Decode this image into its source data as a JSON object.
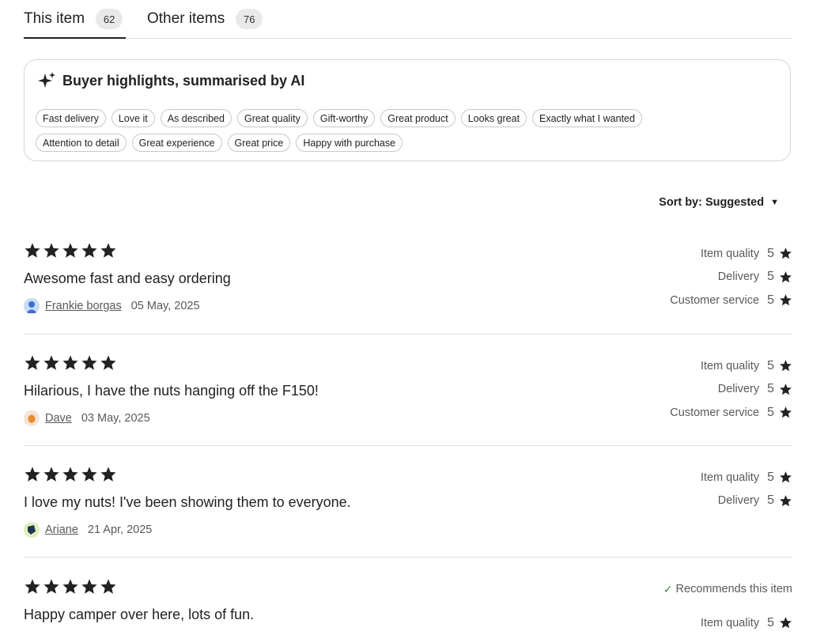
{
  "tabs": [
    {
      "label": "This item",
      "count": "62"
    },
    {
      "label": "Other items",
      "count": "76"
    }
  ],
  "highlights": {
    "title": "Buyer highlights, summarised by AI",
    "chips_row1": [
      "Fast delivery",
      "Love it",
      "As described",
      "Great quality",
      "Gift-worthy",
      "Great product",
      "Looks great",
      "Exactly what I wanted"
    ],
    "chips_row2": [
      "Attention to detail",
      "Great experience",
      "Great price",
      "Happy with purchase"
    ]
  },
  "sort": {
    "label": "Sort by: Suggested"
  },
  "reviews": [
    {
      "rating": 5,
      "text": "Awesome fast and easy ordering",
      "reviewer": "Frankie borgas",
      "date": "05 May, 2025",
      "ratings": [
        {
          "label": "Item quality",
          "value": "5"
        },
        {
          "label": "Delivery",
          "value": "5"
        },
        {
          "label": "Customer service",
          "value": "5"
        }
      ]
    },
    {
      "rating": 5,
      "text": "Hilarious, I have the nuts hanging off the F150!",
      "reviewer": "Dave",
      "date": "03 May, 2025",
      "ratings": [
        {
          "label": "Item quality",
          "value": "5"
        },
        {
          "label": "Delivery",
          "value": "5"
        },
        {
          "label": "Customer service",
          "value": "5"
        }
      ]
    },
    {
      "rating": 5,
      "text": "I love my nuts! I've been showing them to everyone.",
      "reviewer": "Ariane",
      "date": "21 Apr, 2025",
      "ratings": [
        {
          "label": "Item quality",
          "value": "5"
        },
        {
          "label": "Delivery",
          "value": "5"
        }
      ]
    },
    {
      "rating": 5,
      "text": "Happy camper over here, lots of fun.",
      "recommend": "Recommends this item",
      "ratings": [
        {
          "label": "Item quality",
          "value": "5"
        }
      ]
    }
  ],
  "colors": {
    "star": "#222222",
    "recommend_check": "#3a8f3a"
  }
}
